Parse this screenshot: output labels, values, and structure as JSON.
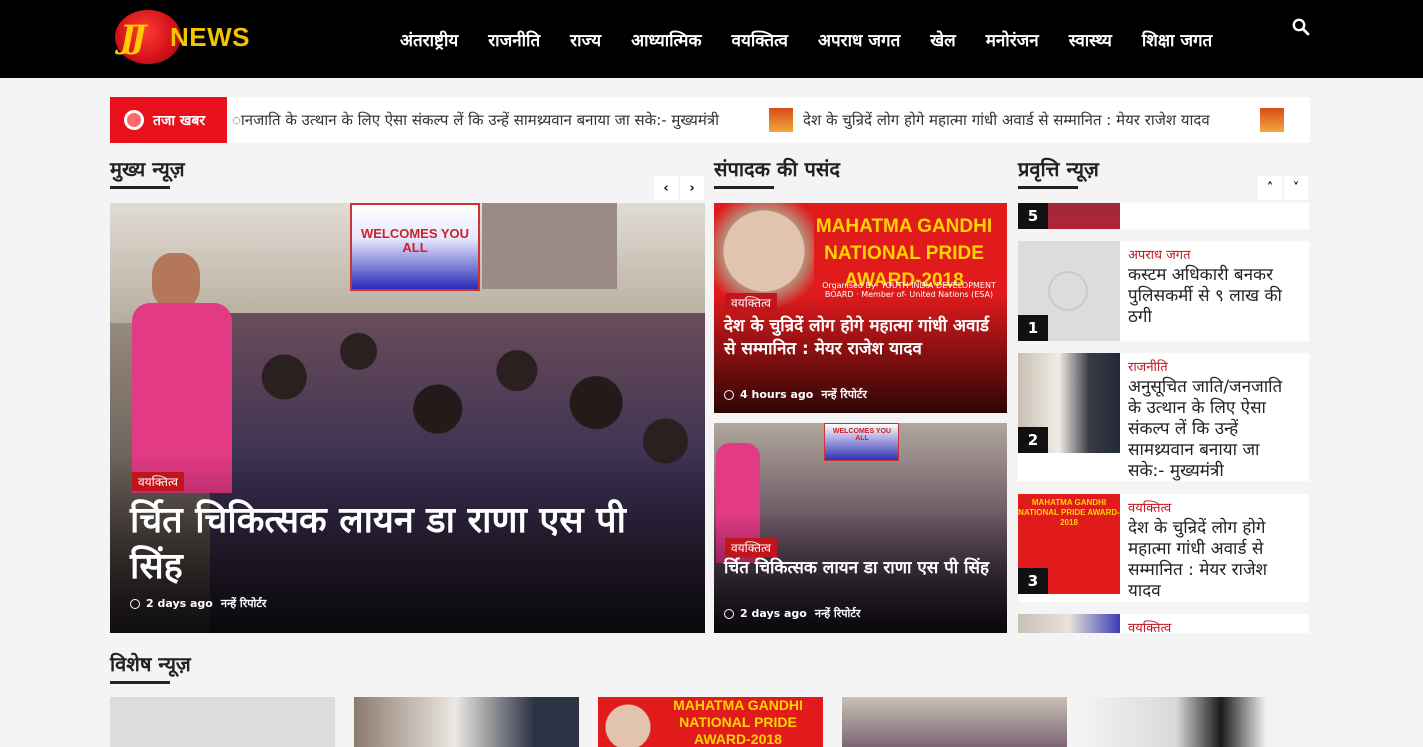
{
  "header": {
    "logo_text": "NEWS",
    "logo_mark": "JJ",
    "nav": [
      "अंतराष्ट्रीय",
      "राजनीति",
      "राज्य",
      "आध्यात्मिक",
      "वयक्तित्व",
      "अपराध जगत",
      "खेल",
      "मनोरंजन",
      "स्वास्थ्य",
      "शिक्षा जगत"
    ],
    "search_icon": "search-icon"
  },
  "ticker": {
    "label": "तजा खबर",
    "items": [
      "ानजाति के उत्थान के लिए ऐसा संकल्प लें कि उन्हें सामथ्र्यवान बनाया जा सके:- मुख्यमंत्री",
      "देश के चुन्रिदें लोग होगे महात्मा गांधी अवार्ड से सम्मानित : मेयर राजेश यादव"
    ]
  },
  "sections": {
    "main": "मुख्य न्यूज़",
    "editor": "संपादक की पसंद",
    "trending": "प्रवृत्ति न्यूज़",
    "special": "विशेष न्यूज़"
  },
  "main_story": {
    "category": "वयक्तित्व",
    "title": "र्चित चिकित्सक लायन डा राणा एस पी सिंह",
    "time": "2 days ago",
    "author": "नन्हें रिपोर्टर"
  },
  "main_banner_text": "WELCOMES YOU ALL",
  "editor_stories": [
    {
      "category": "वयक्तित्व",
      "title": "देश के चुन्रिदें लोग होगे महात्मा गांधी अवार्ड से सम्मानित : मेयर राजेश यादव",
      "time": "4 hours ago",
      "author": "नन्हें रिपोर्टर",
      "poster": "MAHATMA GANDHI NATIONAL PRIDE AWARD-2018",
      "poster_org": "Organised By- YOUTH INDIA DEVELOPMENT BOARD · Member of- United Nations (ESA)"
    },
    {
      "category": "वयक्तित्व",
      "title": "र्चित चिकित्सक लायन डा राणा एस पी सिंह",
      "time": "2 days ago",
      "author": "नन्हें रिपोर्टर",
      "banner": "WELCOMES YOU ALL"
    }
  ],
  "trending": [
    {
      "num": "5",
      "category": "",
      "title": ""
    },
    {
      "num": "1",
      "category": "अपराध जगत",
      "title": "कस्टम अधिकारी बनकर पुलिसकर्मी से ९ लाख की ठगी"
    },
    {
      "num": "2",
      "category": "राजनीति",
      "title": "अनुसूचित जाति/जनजाति के उत्थान के लिए ऐसा संकल्प लें कि उन्हें सामथ्र्यवान बनाया जा सके:- मुख्यमंत्री"
    },
    {
      "num": "3",
      "category": "वयक्तित्व",
      "title": "देश के चुन्रिदें लोग होगे महात्मा गांधी अवार्ड से सम्मानित : मेयर राजेश यादव"
    },
    {
      "num": "",
      "category": "वयक्तित्व",
      "title": ""
    }
  ],
  "special_poster": "MAHATMA GANDHI NATIONAL PRIDE AWARD-2018",
  "colors": {
    "accent": "#c0151d",
    "ticker_red": "#e8101b",
    "header": "#000000",
    "logo_yellow": "#f5c400"
  }
}
